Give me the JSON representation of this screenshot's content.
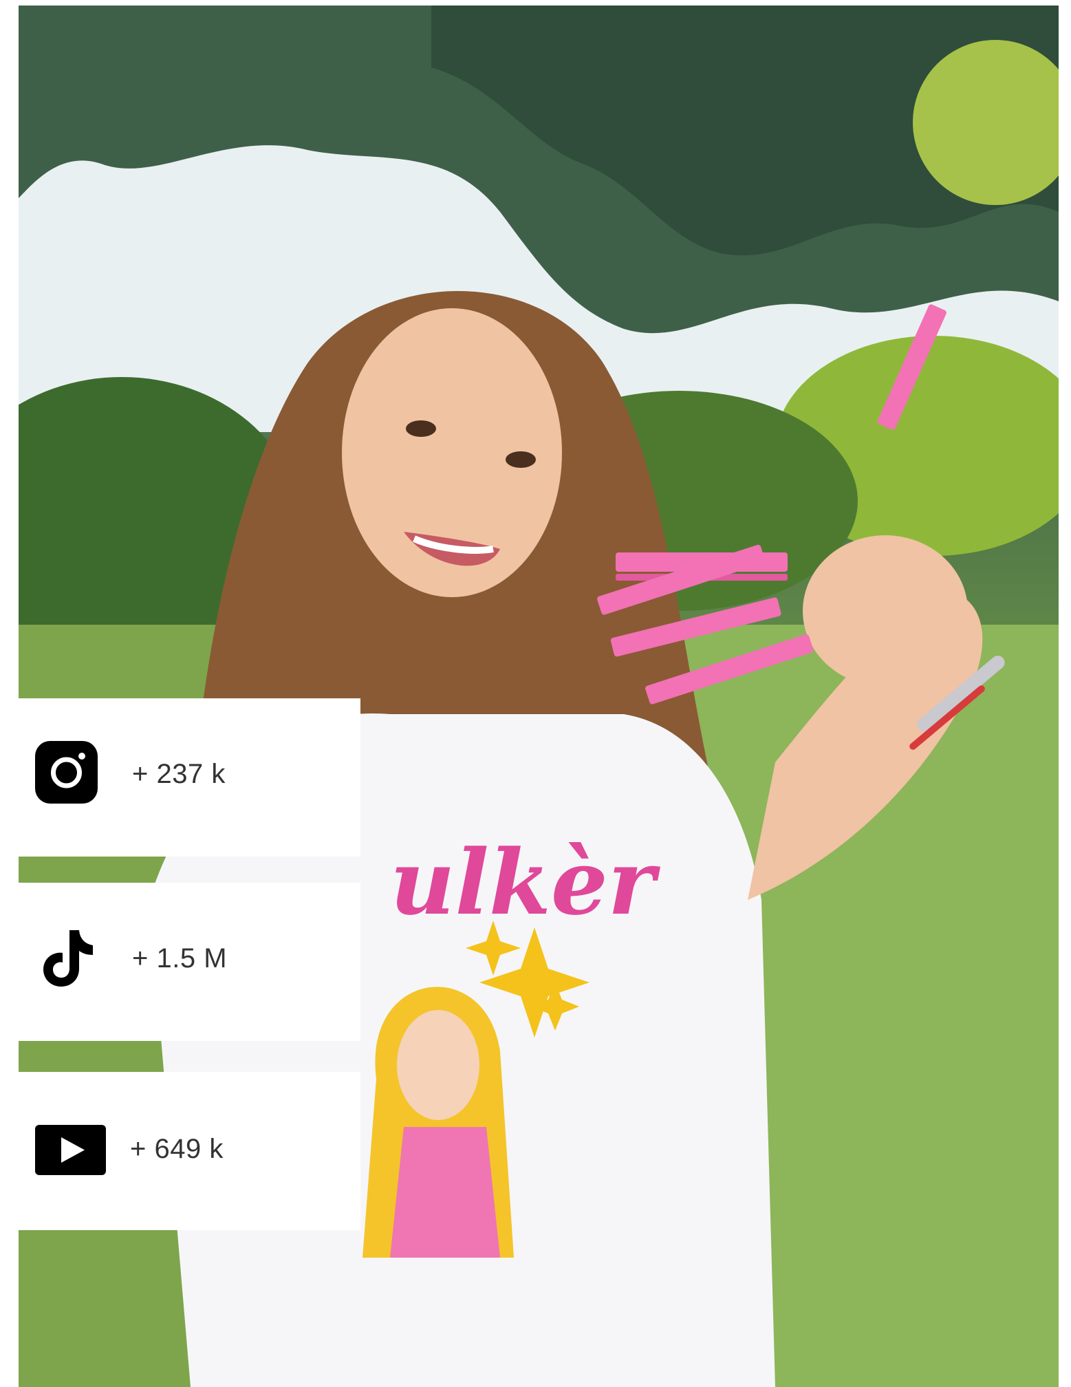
{
  "photo": {
    "alt_subject": "woman-with-pink-clothespin-nails",
    "shirt_text": "ulkèr"
  },
  "social_stats": [
    {
      "platform": "instagram",
      "icon": "instagram-icon",
      "value": "+ 237 k"
    },
    {
      "platform": "tiktok",
      "icon": "tiktok-icon",
      "value": "+ 1.5 M"
    },
    {
      "platform": "youtube",
      "icon": "youtube-icon",
      "value": "+ 649 k"
    }
  ],
  "colors": {
    "icon_bg": "#000000",
    "card_bg": "#ffffff",
    "text": "#333333",
    "accent_pink": "#f272b5"
  }
}
